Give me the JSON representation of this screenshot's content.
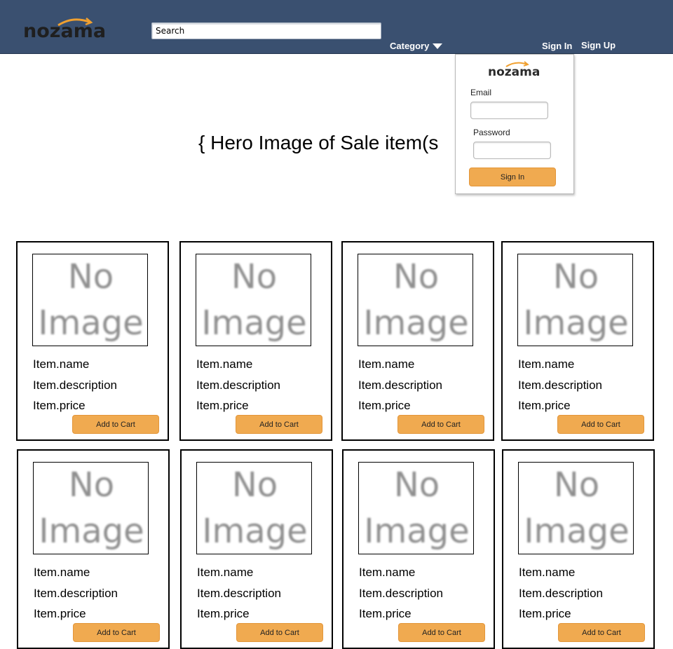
{
  "header": {
    "logo_text": "nozama",
    "search_placeholder": "Search",
    "category_label": "Category",
    "sign_in_label": "Sign In",
    "sign_up_label": "Sign Up"
  },
  "hero": {
    "text": "{ Hero Image of Sale item(s"
  },
  "login": {
    "logo_text": "nozama",
    "email_label": "Email",
    "password_label": "Password",
    "submit_label": "Sign In"
  },
  "products": [
    {
      "image_text_1": "No",
      "image_text_2": "Image",
      "name": "Item.name",
      "description": "Item.description",
      "price": "Item.price",
      "button": "Add to Cart"
    },
    {
      "image_text_1": "No",
      "image_text_2": "Image",
      "name": "Item.name",
      "description": "Item.description",
      "price": "Item.price",
      "button": "Add to Cart"
    },
    {
      "image_text_1": "No",
      "image_text_2": "Image",
      "name": "Item.name",
      "description": "Item.description",
      "price": "Item.price",
      "button": "Add to Cart"
    },
    {
      "image_text_1": "No",
      "image_text_2": "Image",
      "name": "Item.name",
      "description": "Item.description",
      "price": "Item.price",
      "button": "Add to Cart"
    },
    {
      "image_text_1": "No",
      "image_text_2": "Image",
      "name": "Item.name",
      "description": "Item.description",
      "price": "Item.price",
      "button": "Add to Cart"
    },
    {
      "image_text_1": "No",
      "image_text_2": "Image",
      "name": "Item.name",
      "description": "Item.description",
      "price": "Item.price",
      "button": "Add to Cart"
    },
    {
      "image_text_1": "No",
      "image_text_2": "Image",
      "name": "Item.name",
      "description": "Item.description",
      "price": "Item.price",
      "button": "Add to Cart"
    },
    {
      "image_text_1": "No",
      "image_text_2": "Image",
      "name": "Item.name",
      "description": "Item.description",
      "price": "Item.price",
      "button": "Add to Cart"
    }
  ],
  "colors": {
    "header_bg": "#3a5070",
    "accent_orange": "#f0aa50",
    "logo_arc": "#f0a030"
  }
}
